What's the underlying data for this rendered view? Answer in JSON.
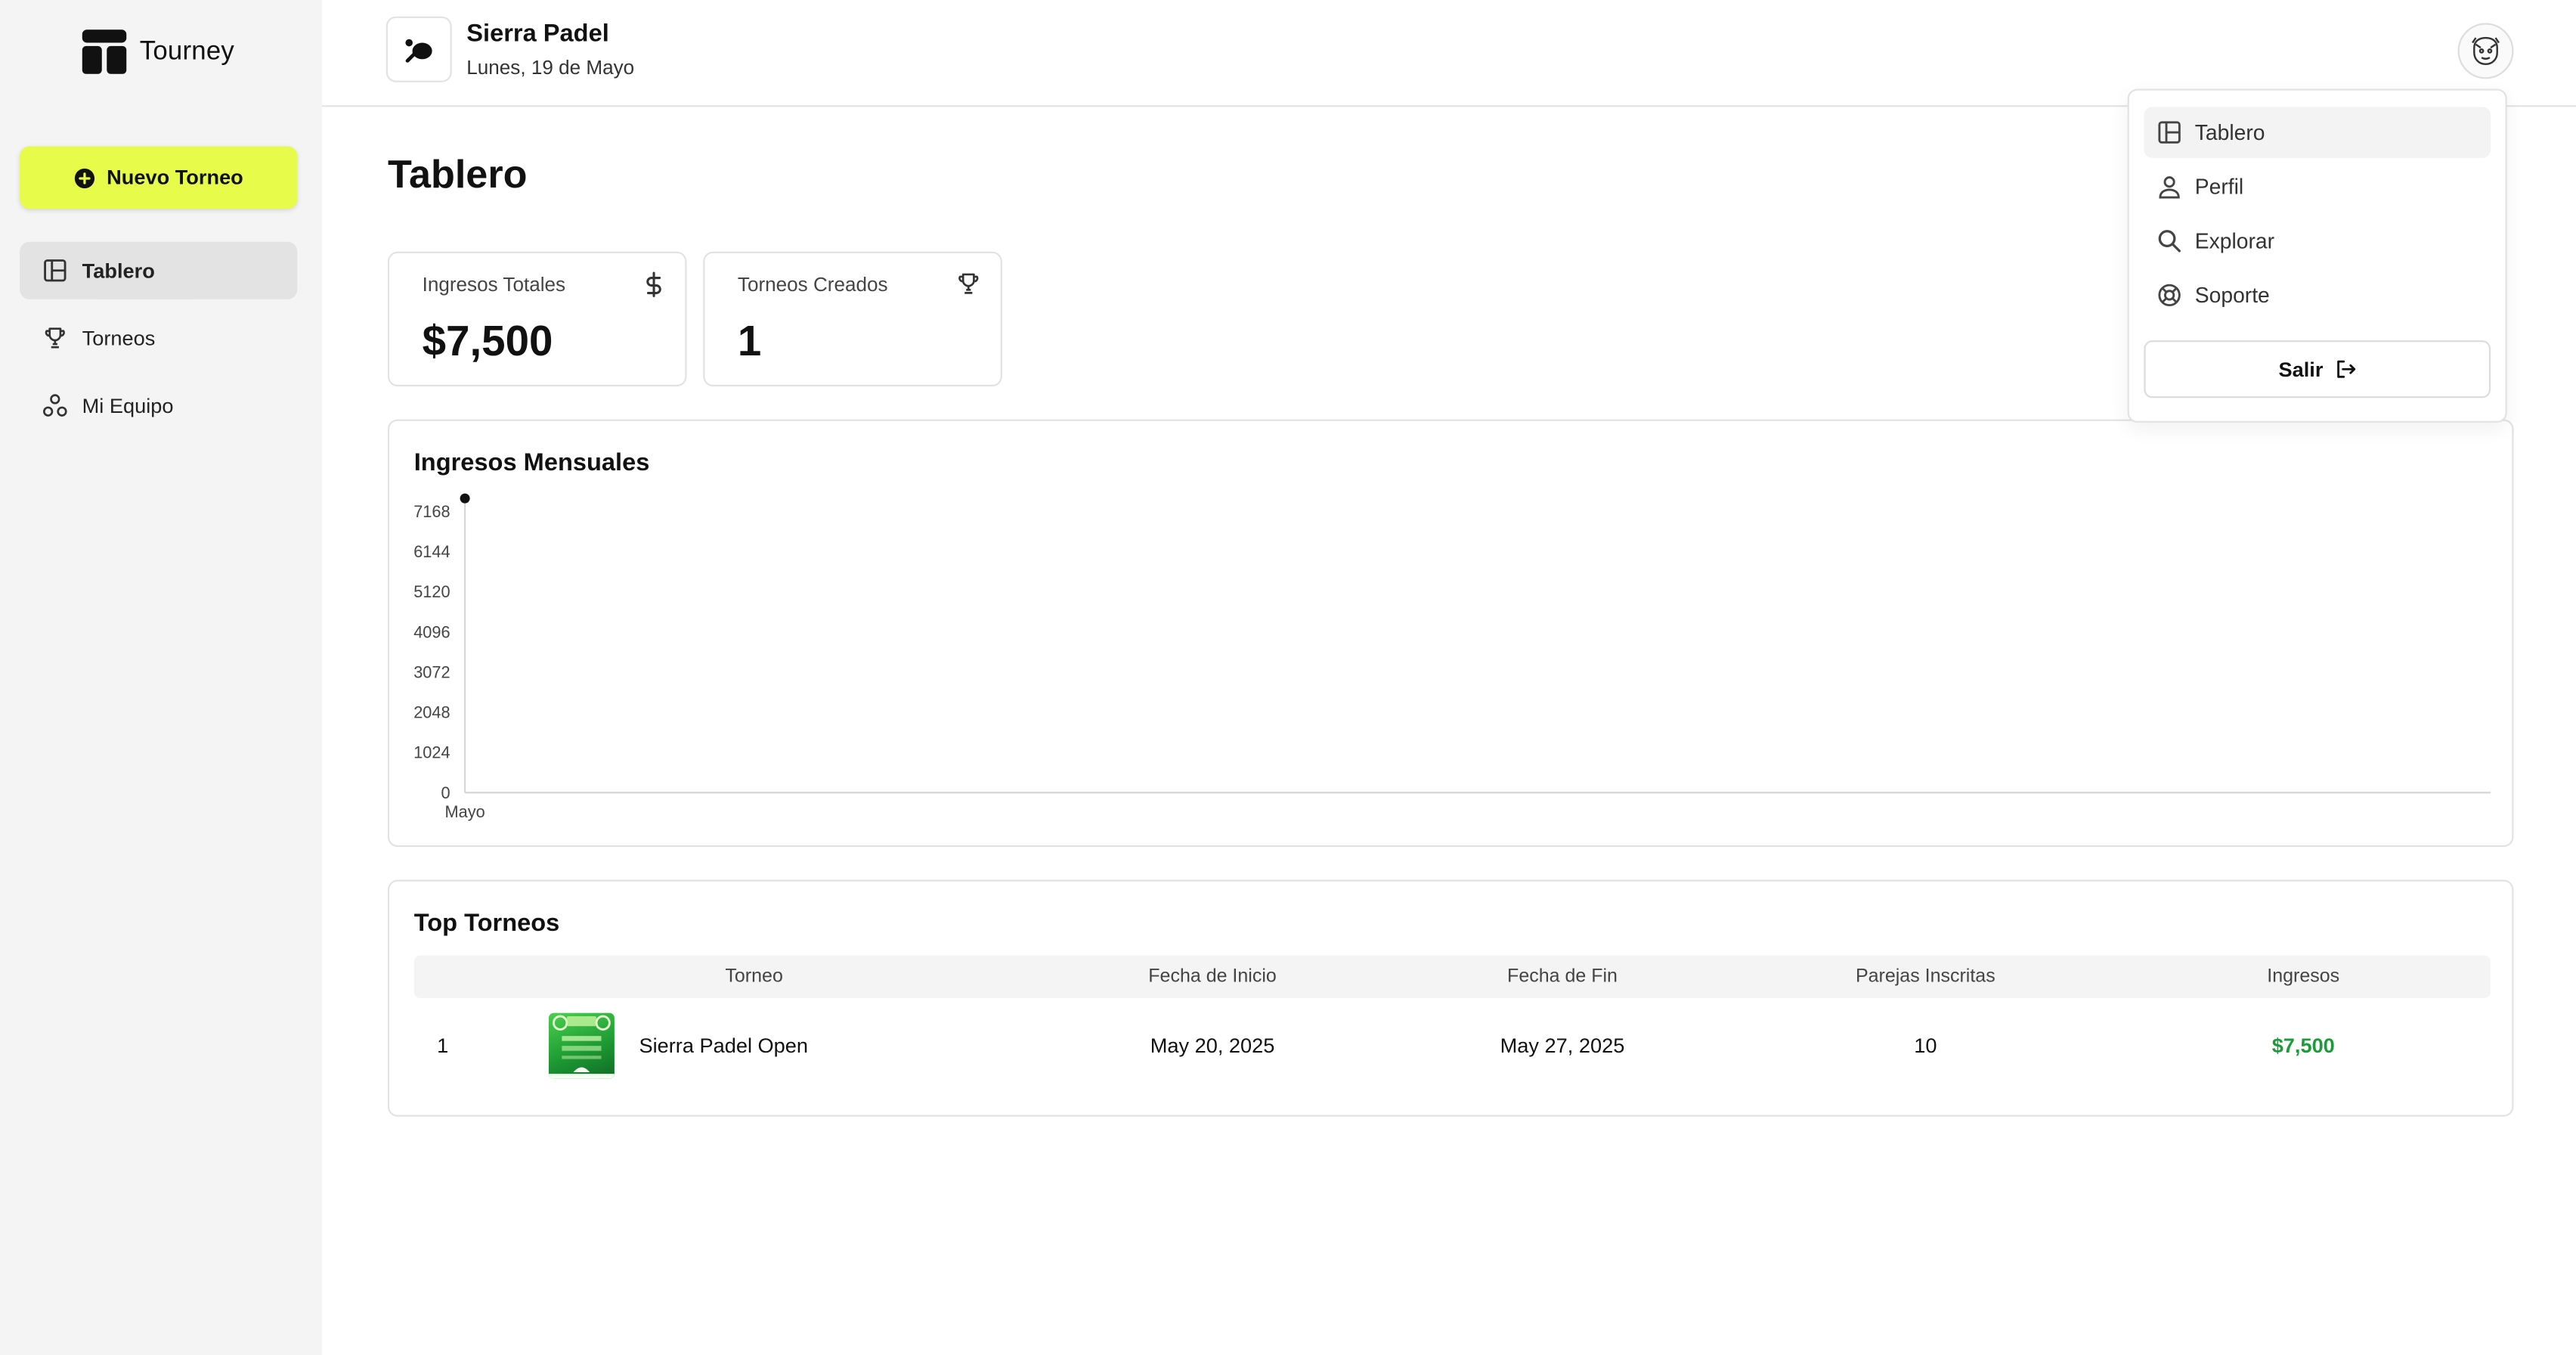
{
  "app": {
    "name": "Tourney"
  },
  "sidebar": {
    "new_button": "Nuevo Torneo",
    "items": [
      {
        "label": "Tablero",
        "icon": "layout-icon",
        "active": true
      },
      {
        "label": "Torneos",
        "icon": "trophy-icon",
        "active": false
      },
      {
        "label": "Mi Equipo",
        "icon": "team-icon",
        "active": false
      }
    ]
  },
  "header": {
    "club_name": "Sierra Padel",
    "date": "Lunes, 19 de Mayo"
  },
  "page": {
    "title": "Tablero"
  },
  "stats": [
    {
      "label": "Ingresos Totales",
      "value": "$7,500",
      "icon": "dollar-icon"
    },
    {
      "label": "Torneos Creados",
      "value": "1",
      "icon": "trophy-icon"
    }
  ],
  "monthly_chart": {
    "title": "Ingresos Mensuales",
    "y_ticks": [
      "0",
      "1024",
      "2048",
      "3072",
      "4096",
      "5120",
      "6144",
      "7168"
    ]
  },
  "chart_data": {
    "type": "line",
    "title": "Ingresos Mensuales",
    "categories": [
      "Mayo"
    ],
    "values": [
      7500
    ],
    "ylim": [
      0,
      7168
    ],
    "y_ticks": [
      0,
      1024,
      2048,
      3072,
      4096,
      5120,
      6144,
      7168
    ],
    "grid": false
  },
  "top_tournaments": {
    "title": "Top Torneos",
    "columns": [
      "Torneo",
      "Fecha de Inicio",
      "Fecha de Fin",
      "Parejas Inscritas",
      "Ingresos"
    ],
    "rows": [
      {
        "rank": "1",
        "name": "Sierra Padel Open",
        "start": "May 20, 2025",
        "end": "May 27, 2025",
        "pairs": "10",
        "revenue": "$7,500"
      }
    ]
  },
  "user_menu": {
    "items": [
      {
        "label": "Tablero",
        "icon": "layout-icon",
        "active": true
      },
      {
        "label": "Perfil",
        "icon": "user-icon",
        "active": false
      },
      {
        "label": "Explorar",
        "icon": "search-icon",
        "active": false
      },
      {
        "label": "Soporte",
        "icon": "lifebuoy-icon",
        "active": false
      }
    ],
    "logout": "Salir"
  },
  "colors": {
    "accent": "#e6fb4a",
    "revenue_green": "#1f9a3a",
    "sidebar_bg": "#f4f4f4"
  }
}
